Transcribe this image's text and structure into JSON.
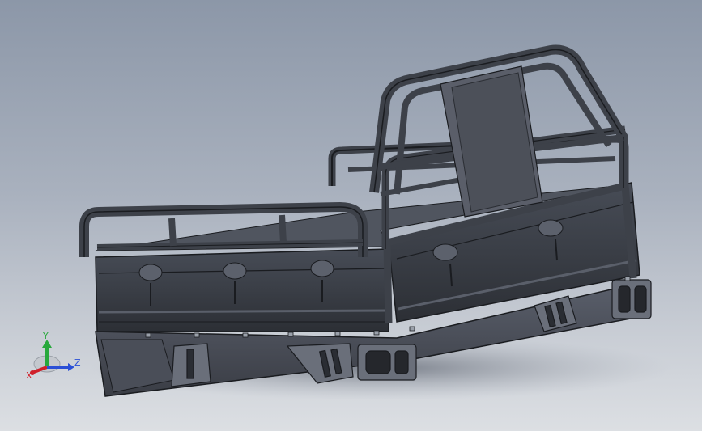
{
  "viewport": {
    "model_name": "ute-tray-canopy-frame"
  },
  "triad": {
    "x_label": "X",
    "y_label": "Y",
    "z_label": "Z",
    "colors": {
      "x": "#d0202a",
      "y": "#28a83c",
      "z": "#2a4fd6"
    }
  }
}
